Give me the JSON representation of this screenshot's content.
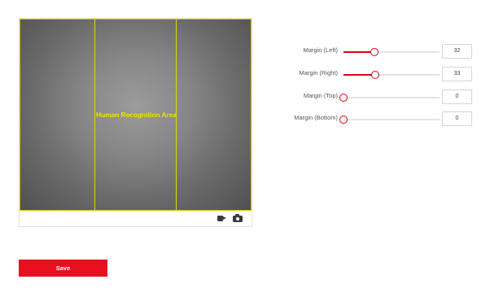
{
  "video": {
    "area_label": "Human Recognition Area",
    "toolbar_icons": [
      "record-icon",
      "camera-icon"
    ]
  },
  "margins": [
    {
      "label": "Margin (Left)",
      "value": "32",
      "percent": 0.32
    },
    {
      "label": "Margin (Right)",
      "value": "33",
      "percent": 0.33
    },
    {
      "label": "Margin (Top)",
      "value": "0",
      "percent": 0
    },
    {
      "label": "Margin (Bottom)",
      "value": "0",
      "percent": 0
    }
  ],
  "actions": {
    "save_label": "Save"
  },
  "colors": {
    "accent": "#e00012",
    "detection_box": "#e8d800"
  }
}
